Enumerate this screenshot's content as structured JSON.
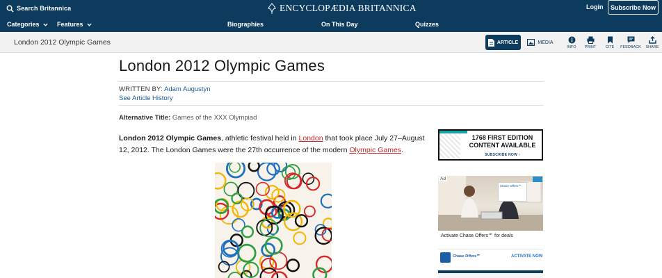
{
  "header": {
    "search_label": "Search Britannica",
    "logo_text": "ENCYCLOPÆDIA BRITANNICA",
    "login_label": "Login",
    "subscribe_label": "Subscribe Now"
  },
  "nav": {
    "categories": "Categories",
    "features": "Features",
    "biographies": "Biographies",
    "on_this_day": "On This Day",
    "quizzes": "Quizzes"
  },
  "subheader": {
    "page_name": "London 2012 Olympic Games",
    "article_label": "ARTICLE",
    "media_label": "MEDIA",
    "tools": [
      "INFO",
      "PRINT",
      "CITE",
      "FEEDBACK",
      "SHARE"
    ]
  },
  "article": {
    "title": "London 2012 Olympic Games",
    "written_by_label": "WRITTEN BY:",
    "author": "Adam Augustyn",
    "history_link": "See Article History",
    "alt_title_label": "Alternative Title:",
    "alt_title_value": "Games of the XXX Olympiad",
    "para_bold": "London 2012 Olympic Games",
    "para_text_1": ", athletic festival held in ",
    "para_link_1": "London",
    "para_text_2": " that took place July 27–August 12, 2012. The London Games were the 27th occurrence of the modern ",
    "para_link_2": "Olympic Games",
    "para_text_3": "."
  },
  "ads": {
    "ad1_line1": "1768 FIRST EDITION",
    "ad1_line2": "CONTENT AVAILABLE",
    "ad1_cta": "SUBSCRIBE NOW ›",
    "ad2_tag": "Ad",
    "ad2_card_title": "Chase Offers℠",
    "ad2_text": "Activate Chase Offers℠ for deals",
    "ad2_brand": "Chase Offers℠",
    "ad2_cta": "ACTIVATE NOW"
  },
  "colors": {
    "brand_navy": "#0d3b5e",
    "link_blue": "#1a5a96",
    "link_red": "#c1272d"
  }
}
